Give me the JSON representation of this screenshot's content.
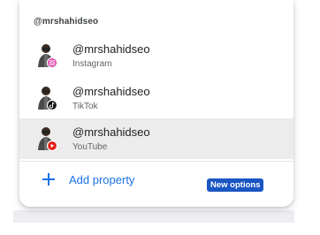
{
  "section_label": "@mrshahidseo",
  "accounts": [
    {
      "handle": "@mrshahidseo",
      "platform": "Instagram",
      "icon": "instagram-icon",
      "badge_color": "#d6249f"
    },
    {
      "handle": "@mrshahidseo",
      "platform": "TikTok",
      "icon": "tiktok-icon",
      "badge_color": "#111111"
    },
    {
      "handle": "@mrshahidseo",
      "platform": "YouTube",
      "icon": "youtube-icon",
      "badge_color": "#e62117"
    }
  ],
  "selected_index": 2,
  "add_property": {
    "label": "Add property",
    "icon": "plus-icon"
  },
  "badge": {
    "label": "New options"
  },
  "colors": {
    "accent": "#1a73e8",
    "badge_bg": "#1a56c4",
    "selected_bg": "#ececec"
  }
}
